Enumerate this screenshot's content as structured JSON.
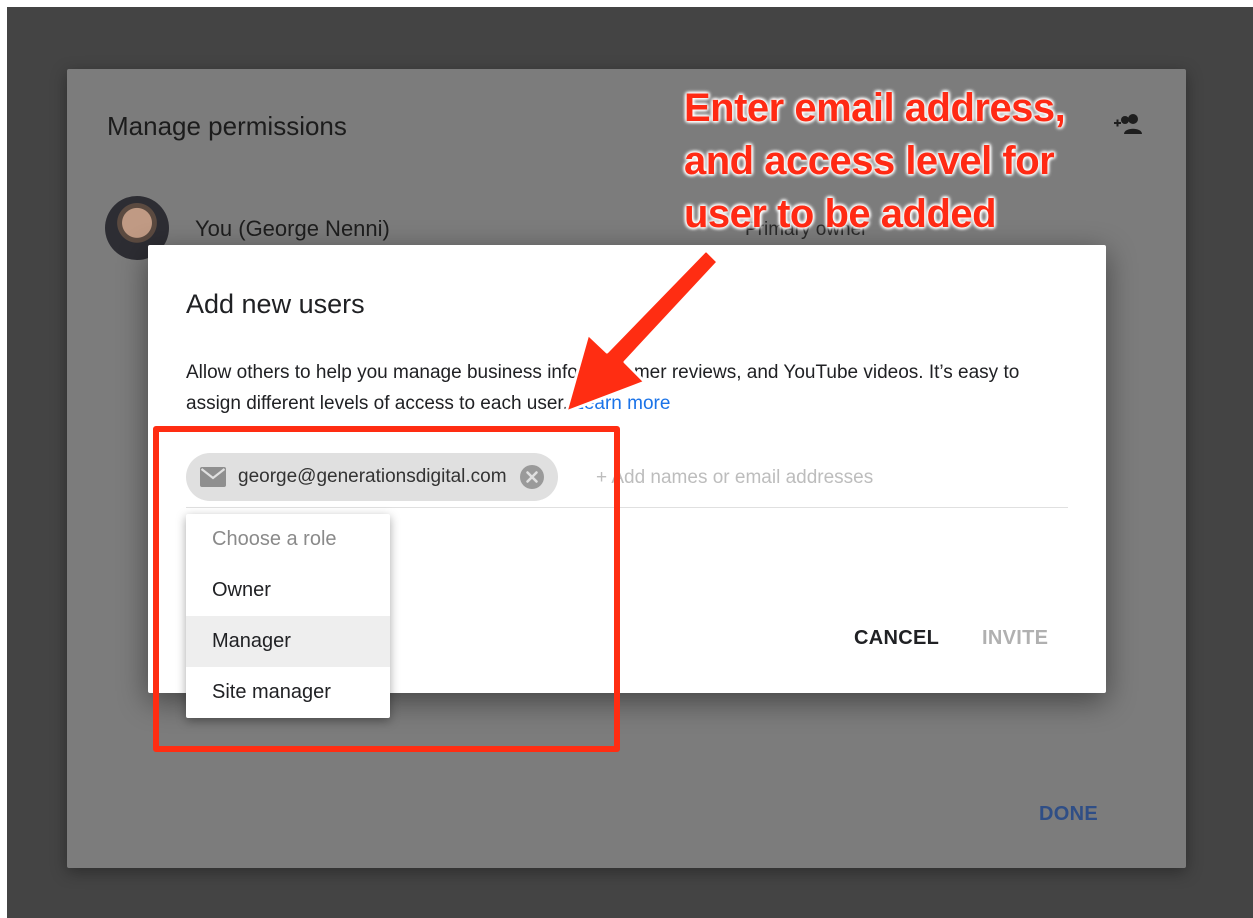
{
  "permissions_dialog": {
    "title": "Manage permissions",
    "user_name": "You (George Nenni)",
    "user_role": "Primary owner",
    "done_label": "DONE"
  },
  "add_users_dialog": {
    "title": "Add new users",
    "description": "Allow others to help you manage business info, customer reviews, and YouTube videos. It’s easy to assign different levels of access to each user.",
    "learn_more": "Learn more",
    "chip_email": "george@generationsdigital.com",
    "input_placeholder": "+ Add names or email addresses",
    "cancel_label": "CANCEL",
    "invite_label": "INVITE"
  },
  "role_menu": {
    "header": "Choose a role",
    "items": [
      "Owner",
      "Manager",
      "Site manager"
    ],
    "highlighted": "Manager"
  },
  "annotation": {
    "callout": "Enter email address, and access level for user to be added",
    "color": "#ff2d12"
  },
  "colors": {
    "link": "#1a73e8",
    "done": "#2f4e86",
    "backdrop": "#444444"
  }
}
